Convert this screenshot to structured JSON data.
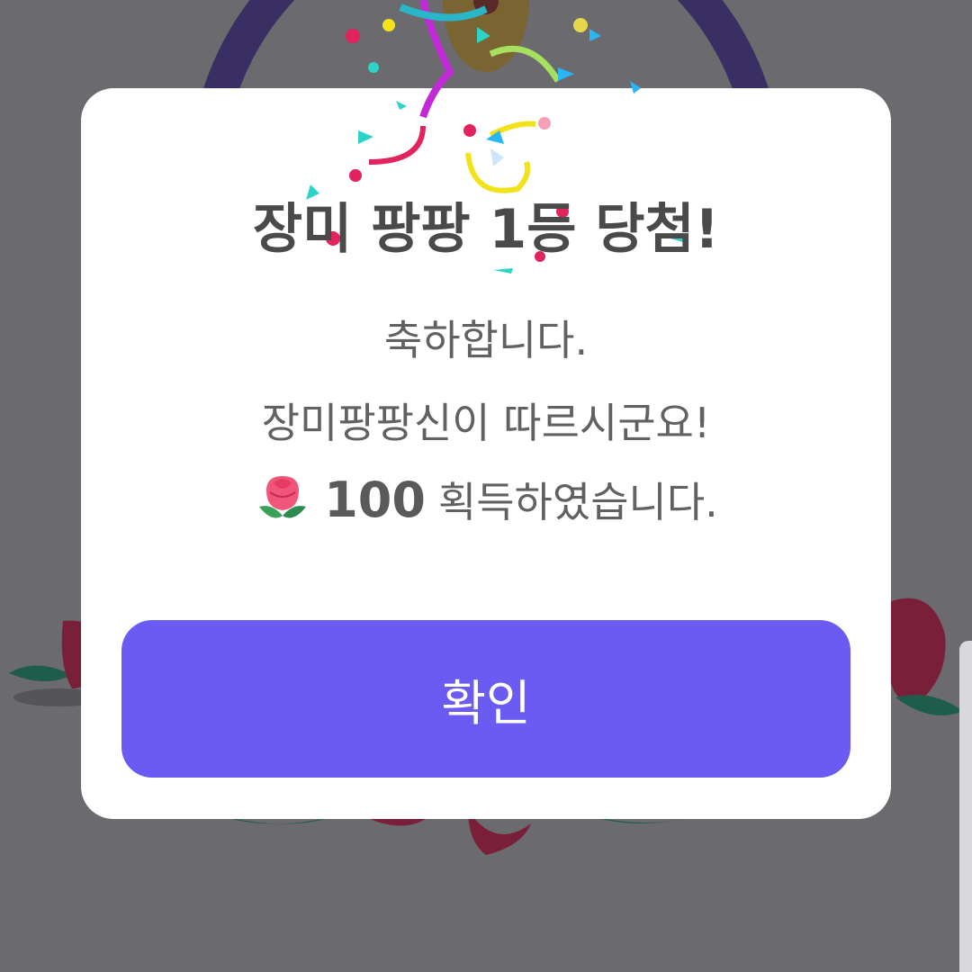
{
  "dialog": {
    "title": "장미 팡팡 1등 당첨!",
    "line1": "축하합니다.",
    "line2": "장미팡팡신이 따르시군요!",
    "reward_icon": "rose-icon",
    "reward_amount": "100",
    "reward_suffix": "획득하였습니다.",
    "confirm_label": "확인"
  },
  "colors": {
    "accent": "#6b5bf2",
    "overlay": "#6b6a6e",
    "title_text": "#4a4a4a",
    "body_text": "#616161"
  }
}
